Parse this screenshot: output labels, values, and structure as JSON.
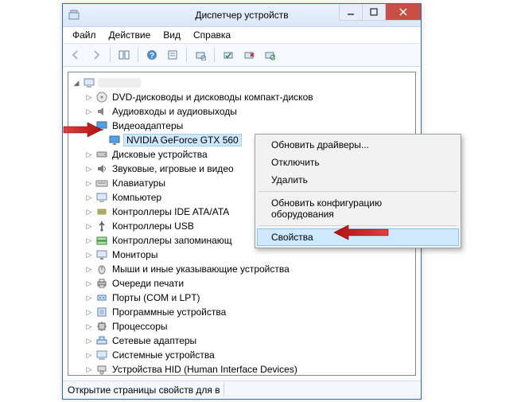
{
  "window": {
    "title": "Диспетчер устройств"
  },
  "menubar": {
    "file": "Файл",
    "action": "Действие",
    "view": "Вид",
    "help": "Справка"
  },
  "tree": {
    "root": "",
    "n_dvd": "DVD-дисководы и дисководы компакт-дисков",
    "n_audio": "Аудиовходы и аудиовыходы",
    "n_video": "Видеоадаптеры",
    "n_gpu": "NVIDIA GeForce GTX 560",
    "n_disk": "Дисковые устройства",
    "n_sound": "Звуковые, игровые и видео",
    "n_keyboard": "Клавиатуры",
    "n_computer": "Компьютер",
    "n_ide": "Контроллеры IDE ATA/ATA",
    "n_usb": "Контроллеры USB",
    "n_storage": "Контроллеры запоминающ",
    "n_monitor": "Мониторы",
    "n_mouse": "Мыши и иные указывающие устройства",
    "n_printq": "Очереди печати",
    "n_ports": "Порты (COM и LPT)",
    "n_software": "Программные устройства",
    "n_cpu": "Процессоры",
    "n_net": "Сетевые адаптеры",
    "n_system": "Системные устройства",
    "n_hid": "Устройства HID (Human Interface Devices)"
  },
  "context_menu": {
    "update": "Обновить драйверы...",
    "disable": "Отключить",
    "delete": "Удалить",
    "rescan": "Обновить конфигурацию оборудования",
    "properties": "Свойства"
  },
  "statusbar": {
    "text": "Открытие страницы свойств для в"
  }
}
